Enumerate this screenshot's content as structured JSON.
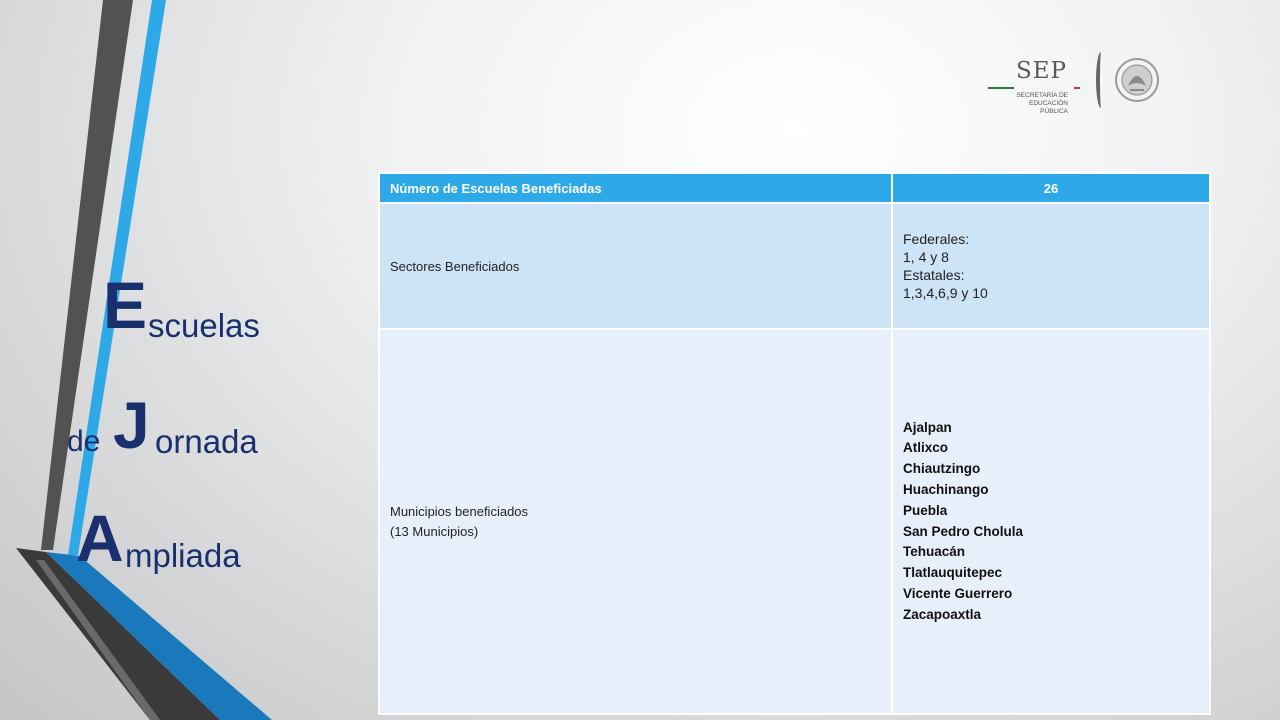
{
  "logo": {
    "main": "SEP",
    "subtitle_line1": "SECRETARÍA DE",
    "subtitle_line2": "EDUCACIÓN PÚBLICA",
    "colors": {
      "green": "#2f7a3e",
      "red": "#c0392b",
      "gray": "#5a5a5a"
    }
  },
  "title": {
    "line1_initial": "E",
    "line1_rest": "scuelas",
    "line2_prefix": "de",
    "line2_initial": "J",
    "line2_rest": "ornada",
    "line3_initial": "A",
    "line3_rest": "mpliada",
    "color": "#1a2f6e"
  },
  "table": {
    "header": {
      "label": "Número de Escuelas Beneficiadas",
      "value": "26",
      "color": "#2ea9e8"
    },
    "sectors": {
      "label": "Sectores Beneficiados",
      "lines": [
        "Federales:",
        "1, 4 y 8",
        "Estatales:",
        "1,3,4,6,9 y 10"
      ]
    },
    "municipalities": {
      "label": "Municipios beneficiados",
      "sublabel": "(13 Municipios)",
      "items": [
        "Ajalpan",
        "Atlixco",
        "Chiautzingo",
        "Huachinango",
        "Puebla",
        "San Pedro Cholula",
        "Tehuacán",
        "Tlatlauquitepec",
        "Vicente Guerrero",
        "Zacapoaxtla"
      ]
    }
  },
  "decor_colors": {
    "stripe_dark": "#505050",
    "stripe_blue": "#2ea9e8",
    "stripe_darkblue": "#1a6fb0"
  }
}
